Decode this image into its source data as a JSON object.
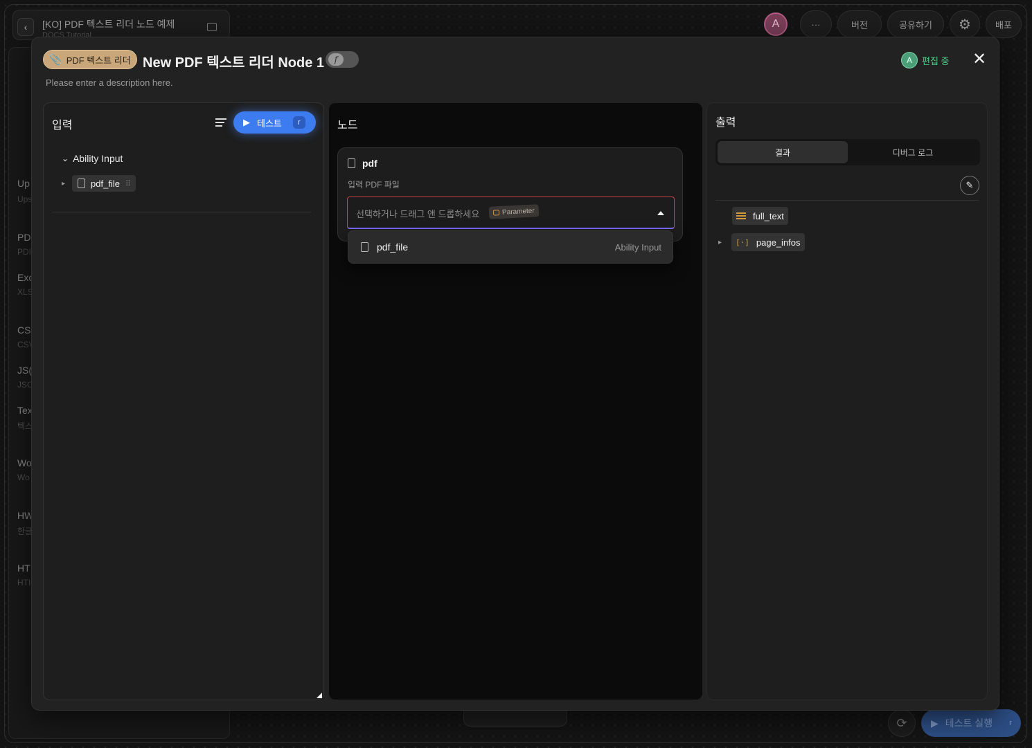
{
  "workspace": {
    "project_title": "[KO] PDF 텍스트 리더 노드 예제",
    "project_subtitle": "DOCS Tutorial",
    "avatar_letter": "A",
    "more_label": "···",
    "version_label": "버전",
    "share_label": "공유하기",
    "deploy_label": "배포",
    "run_test_label": "테스트 실행",
    "run_test_key": "r",
    "sidebar_items": [
      {
        "title": "Up",
        "sub": "Ups"
      },
      {
        "title": "PD",
        "sub": "PDI"
      },
      {
        "title": "Exc",
        "sub": "XLS"
      },
      {
        "title": "CS",
        "sub": "CSV"
      },
      {
        "title": "JS(",
        "sub": "JSC"
      },
      {
        "title": "Tex",
        "sub": "텍스"
      },
      {
        "title": "Wo",
        "sub": "Wo"
      },
      {
        "title": "HW",
        "sub": "한글"
      },
      {
        "title": "HT",
        "sub": "HTI"
      }
    ]
  },
  "modal": {
    "badge_label": "PDF 텍스트 리더",
    "title": "New PDF 텍스트 리더 Node 1",
    "fx_symbol": "f",
    "description": "Please enter a description here.",
    "editor_avatar": "A",
    "editing_label": "편집 중",
    "accent": "#3d7bf0"
  },
  "input_panel": {
    "title": "입력",
    "test_label": "테스트",
    "test_key": "r",
    "group_label": "Ability Input",
    "field_name": "pdf_file"
  },
  "node_panel": {
    "title": "노드",
    "param_name": "pdf",
    "param_desc": "입력 PDF 파일",
    "select_placeholder": "선택하거나 드래그 앤 드롭하세요",
    "param_badge": "Parameter",
    "option": {
      "name": "pdf_file",
      "source": "Ability Input"
    }
  },
  "output_panel": {
    "title": "출력",
    "tabs": [
      "결과",
      "디버그 로그"
    ],
    "active_tab": 0,
    "fields": [
      {
        "name": "full_text",
        "type": "text",
        "expandable": false
      },
      {
        "name": "page_infos",
        "type": "array",
        "expandable": true
      }
    ]
  }
}
